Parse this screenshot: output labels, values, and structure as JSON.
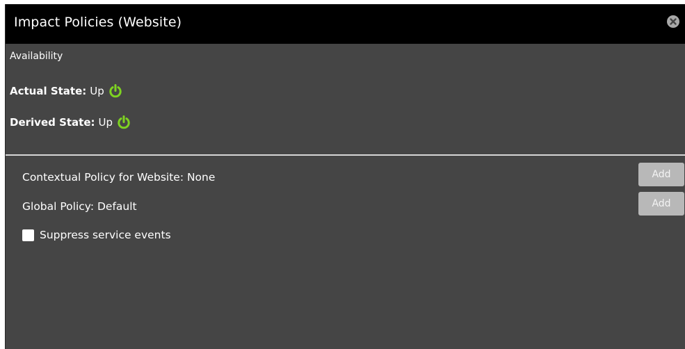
{
  "dialog": {
    "title": "Impact Policies (Website)"
  },
  "availability": {
    "section_label": "Availability",
    "actual_state_label": "Actual State:",
    "actual_state_value": "Up",
    "derived_state_label": "Derived State:",
    "derived_state_value": "Up"
  },
  "policies": {
    "contextual_text": "Contextual Policy for Website: None",
    "global_text": "Global Policy: Default",
    "add_label": "Add",
    "suppress_label": "Suppress service events",
    "suppress_checked": false
  },
  "icons": {
    "close": "close-icon",
    "power": "power-icon"
  },
  "colors": {
    "title_bar": "#000000",
    "panel": "#454545",
    "status_up": "#7ED321",
    "button": "#b8b8b8"
  }
}
